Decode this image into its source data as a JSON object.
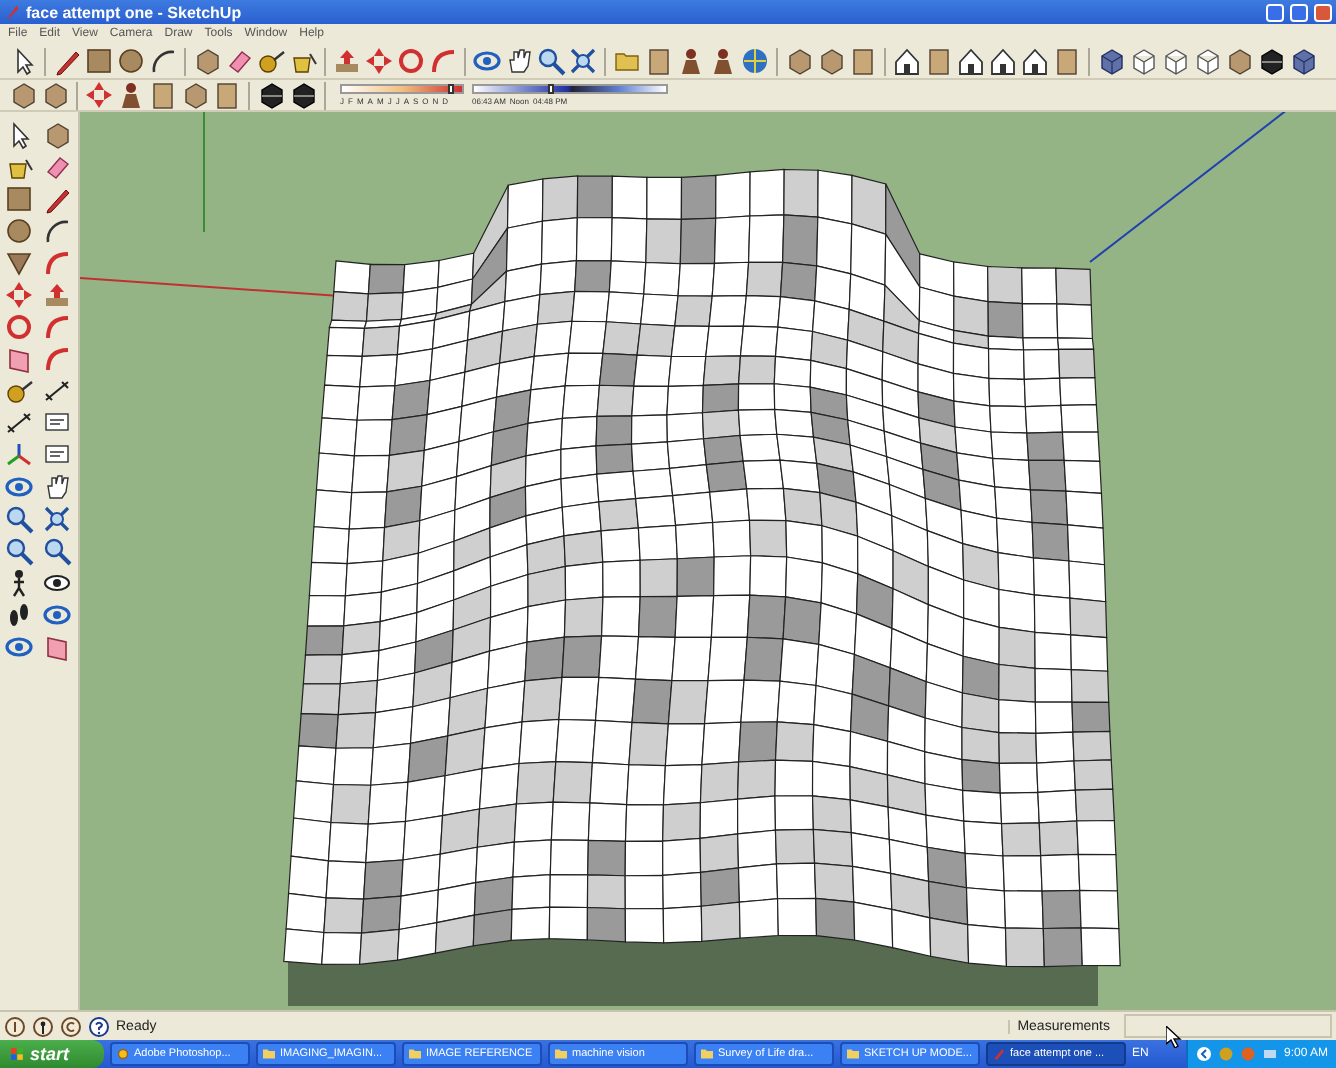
{
  "window": {
    "title": "face attempt one - SketchUp"
  },
  "menu": [
    "File",
    "Edit",
    "View",
    "Camera",
    "Draw",
    "Tools",
    "Window",
    "Help"
  ],
  "shadow_settings": {
    "months": [
      "J",
      "F",
      "M",
      "A",
      "M",
      "J",
      "J",
      "A",
      "S",
      "O",
      "N",
      "D"
    ],
    "month_slider": {
      "level": 0.9
    },
    "time_slider": {
      "level": 0.4
    },
    "time_start": "06:43 AM",
    "time_mid": "Noon",
    "time_end": "04:48 PM"
  },
  "status_bar": {
    "status": "Ready",
    "measurements_label": "Measurements"
  },
  "taskbar": {
    "start": "start",
    "tasks": [
      {
        "label": "Adobe Photoshop...",
        "kind": "photoshop",
        "selected": false
      },
      {
        "label": "IMAGING_IMAGIN...",
        "kind": "folder",
        "selected": false
      },
      {
        "label": "IMAGE REFERENCE",
        "kind": "folder",
        "selected": false
      },
      {
        "label": "machine vision",
        "kind": "folder",
        "selected": false
      },
      {
        "label": "Survey of Life dra...",
        "kind": "folder",
        "selected": false
      },
      {
        "label": "SKETCH UP MODE...",
        "kind": "folder",
        "selected": false
      },
      {
        "label": "face attempt one ...",
        "kind": "sketchup",
        "selected": true
      }
    ],
    "language": "EN",
    "clock": "9:00 AM"
  }
}
